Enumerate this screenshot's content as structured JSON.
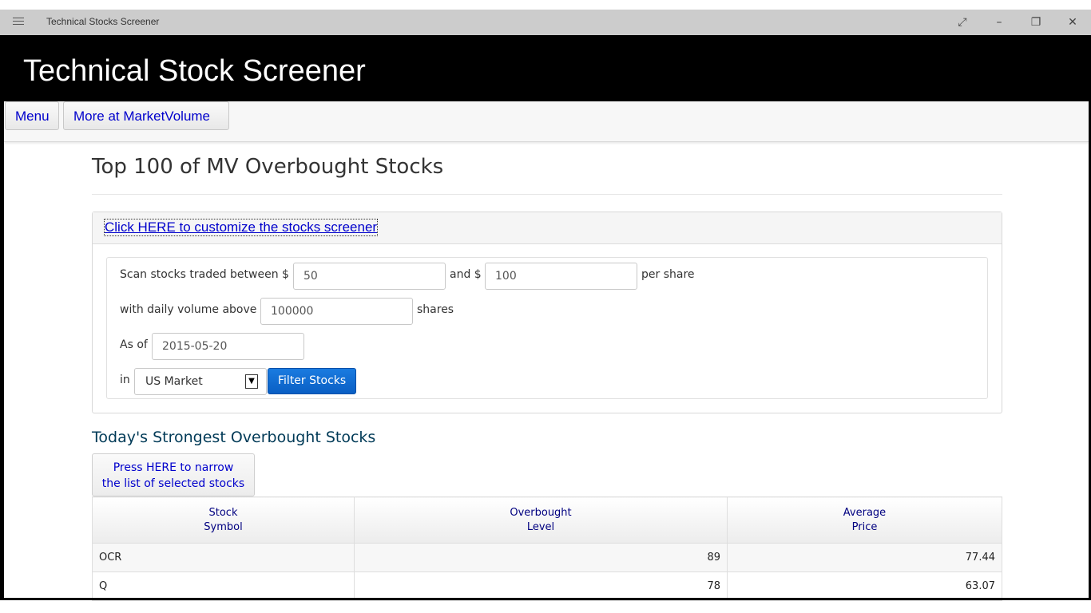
{
  "window": {
    "title": "Technical Stocks Screener",
    "controls": [
      "expand-icon",
      "minimize-icon",
      "restore-icon",
      "close-icon"
    ]
  },
  "banner": {
    "title": "Technical Stock Screener"
  },
  "nav": {
    "menu_label": "Menu",
    "more_label": "More at MarketVolume"
  },
  "page": {
    "title": "Top 100 of MV Overbought Stocks"
  },
  "customize": {
    "link_text": "Click HERE to customize the stocks screener",
    "row1": {
      "prefix": "Scan stocks traded between $",
      "min_price": "50",
      "mid": "and $",
      "max_price": "100",
      "suffix": "per share"
    },
    "row2": {
      "prefix": "with daily volume above",
      "volume": "100000",
      "suffix": "shares"
    },
    "row3": {
      "prefix": "As of",
      "date": "2015-05-20"
    },
    "row4": {
      "prefix": "in",
      "market": "US Market",
      "button": "Filter Stocks"
    }
  },
  "results": {
    "heading": "Today's Strongest Overbought Stocks",
    "narrow_line1": "Press HERE to narrow",
    "narrow_line2": "the list of selected stocks",
    "columns": [
      {
        "line1": "Stock",
        "line2": "Symbol"
      },
      {
        "line1": "Overbought",
        "line2": "Level"
      },
      {
        "line1": "Average",
        "line2": "Price"
      }
    ],
    "rows": [
      {
        "symbol": "OCR",
        "level": "89",
        "price": "77.44"
      },
      {
        "symbol": "Q",
        "level": "78",
        "price": "63.07"
      }
    ]
  },
  "colors": {
    "banner": "#000000",
    "link": "#0000cc",
    "button_primary": "#0a66cc",
    "subhead": "#003a57",
    "table_header_text": "#000080"
  }
}
